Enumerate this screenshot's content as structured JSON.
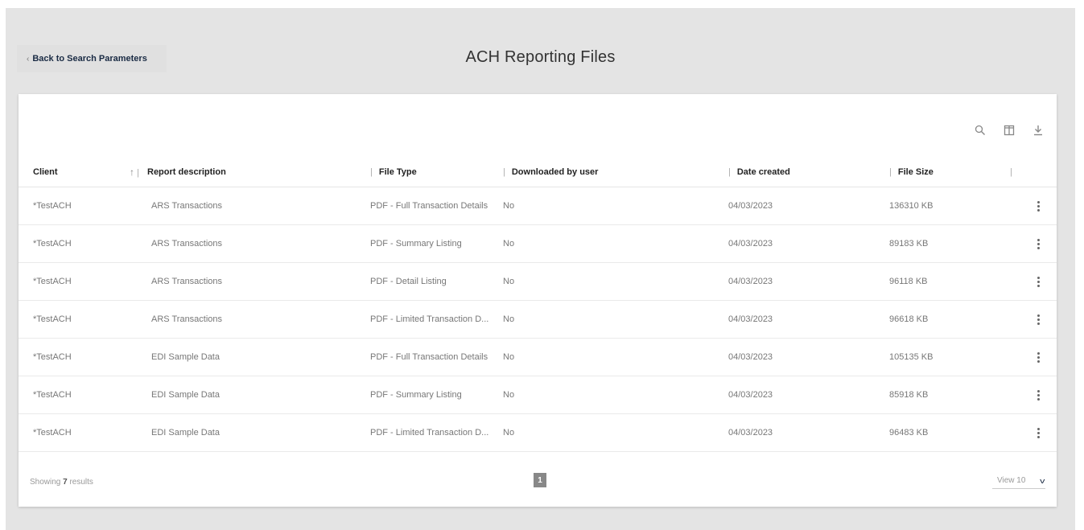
{
  "nav": {
    "back_chevron": "‹",
    "back_label": "Back to Search Parameters"
  },
  "page": {
    "title": "ACH Reporting Files"
  },
  "toolbar": {
    "icons": [
      "search-icon",
      "columns-icon",
      "download-icon"
    ]
  },
  "table": {
    "headers": {
      "client": "Client",
      "report_description": "Report description",
      "file_type": "File Type",
      "downloaded_by_user": "Downloaded by user",
      "date_created": "Date created",
      "file_size": "File Size"
    },
    "rows": [
      {
        "client": "*TestACH",
        "report_description": "ARS Transactions",
        "file_type": "PDF - Full Transaction Details",
        "downloaded": "No",
        "date_created": "04/03/2023",
        "file_size": "136310 KB"
      },
      {
        "client": "*TestACH",
        "report_description": "ARS Transactions",
        "file_type": "PDF - Summary Listing",
        "downloaded": "No",
        "date_created": "04/03/2023",
        "file_size": "89183 KB"
      },
      {
        "client": "*TestACH",
        "report_description": "ARS Transactions",
        "file_type": "PDF - Detail Listing",
        "downloaded": "No",
        "date_created": "04/03/2023",
        "file_size": "96118 KB"
      },
      {
        "client": "*TestACH",
        "report_description": "ARS Transactions",
        "file_type": "PDF - Limited Transaction D...",
        "downloaded": "No",
        "date_created": "04/03/2023",
        "file_size": "96618 KB"
      },
      {
        "client": "*TestACH",
        "report_description": "EDI Sample Data",
        "file_type": "PDF - Full Transaction Details",
        "downloaded": "No",
        "date_created": "04/03/2023",
        "file_size": "105135 KB"
      },
      {
        "client": "*TestACH",
        "report_description": "EDI Sample Data",
        "file_type": "PDF - Summary Listing",
        "downloaded": "No",
        "date_created": "04/03/2023",
        "file_size": "85918 KB"
      },
      {
        "client": "*TestACH",
        "report_description": "EDI Sample Data",
        "file_type": "PDF - Limited Transaction D...",
        "downloaded": "No",
        "date_created": "04/03/2023",
        "file_size": "96483 KB"
      }
    ]
  },
  "footer": {
    "showing_prefix": "Showing ",
    "result_count": "7",
    "showing_suffix": " results",
    "current_page": "1",
    "view_label": "View 10"
  },
  "colors": {
    "background": "#e4e4e4",
    "card": "#ffffff",
    "heading_text": "#1a2b44",
    "pagination_active": "#888888"
  }
}
